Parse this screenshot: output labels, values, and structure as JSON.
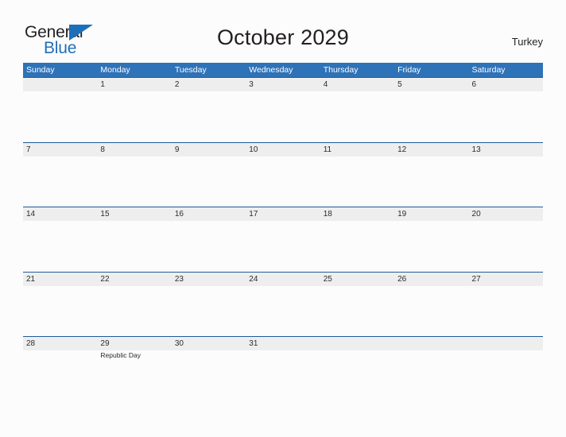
{
  "brand": {
    "name_part1": "General",
    "name_part2": "Blue",
    "triangle_icon": "blue-triangle-logo-mark",
    "accent_color": "#1e6fba"
  },
  "header": {
    "title": "October 2029",
    "month": "October",
    "year": "2029",
    "locale": "Turkey"
  },
  "colors": {
    "header_bar": "#2e72b8",
    "row_divider": "#1f5c99",
    "date_band": "#eeeeee",
    "page_background": "#fcfcfd",
    "text": "#231f20"
  },
  "calendar": {
    "weekdays": [
      "Sunday",
      "Monday",
      "Tuesday",
      "Wednesday",
      "Thursday",
      "Friday",
      "Saturday"
    ],
    "weeks": [
      {
        "days": [
          {
            "date": "",
            "event": ""
          },
          {
            "date": "1",
            "event": ""
          },
          {
            "date": "2",
            "event": ""
          },
          {
            "date": "3",
            "event": ""
          },
          {
            "date": "4",
            "event": ""
          },
          {
            "date": "5",
            "event": ""
          },
          {
            "date": "6",
            "event": ""
          }
        ]
      },
      {
        "days": [
          {
            "date": "7",
            "event": ""
          },
          {
            "date": "8",
            "event": ""
          },
          {
            "date": "9",
            "event": ""
          },
          {
            "date": "10",
            "event": ""
          },
          {
            "date": "11",
            "event": ""
          },
          {
            "date": "12",
            "event": ""
          },
          {
            "date": "13",
            "event": ""
          }
        ]
      },
      {
        "days": [
          {
            "date": "14",
            "event": ""
          },
          {
            "date": "15",
            "event": ""
          },
          {
            "date": "16",
            "event": ""
          },
          {
            "date": "17",
            "event": ""
          },
          {
            "date": "18",
            "event": ""
          },
          {
            "date": "19",
            "event": ""
          },
          {
            "date": "20",
            "event": ""
          }
        ]
      },
      {
        "days": [
          {
            "date": "21",
            "event": ""
          },
          {
            "date": "22",
            "event": ""
          },
          {
            "date": "23",
            "event": ""
          },
          {
            "date": "24",
            "event": ""
          },
          {
            "date": "25",
            "event": ""
          },
          {
            "date": "26",
            "event": ""
          },
          {
            "date": "27",
            "event": ""
          }
        ]
      },
      {
        "days": [
          {
            "date": "28",
            "event": ""
          },
          {
            "date": "29",
            "event": "Republic Day"
          },
          {
            "date": "30",
            "event": ""
          },
          {
            "date": "31",
            "event": ""
          },
          {
            "date": "",
            "event": ""
          },
          {
            "date": "",
            "event": ""
          },
          {
            "date": "",
            "event": ""
          }
        ]
      }
    ]
  }
}
